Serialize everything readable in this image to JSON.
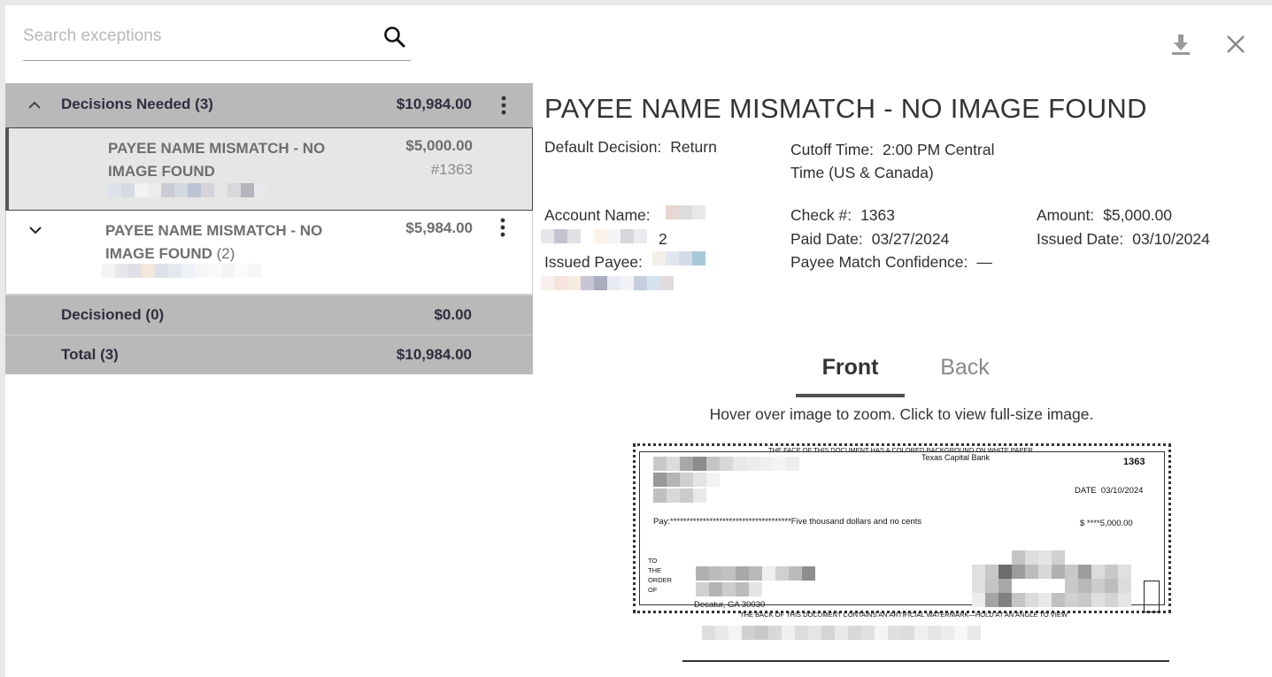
{
  "search": {
    "placeholder": "Search exceptions"
  },
  "toolbar": {
    "download_icon": "download-icon",
    "close_icon": "close-icon"
  },
  "list": {
    "decisions_needed": {
      "label": "Decisions Needed (3)",
      "amount": "$10,984.00"
    },
    "items": [
      {
        "title": "PAYEE NAME MISMATCH - NO IMAGE FOUND",
        "count": "",
        "amount": "$5,000.00",
        "check_number": "#1363",
        "selected": true
      },
      {
        "title": "PAYEE NAME MISMATCH - NO IMAGE FOUND",
        "count": "(2)",
        "amount": "$5,984.00",
        "check_number": "",
        "selected": false
      }
    ],
    "decisioned": {
      "label": "Decisioned (0)",
      "amount": "$0.00"
    },
    "total": {
      "label": "Total (3)",
      "amount": "$10,984.00"
    }
  },
  "detail": {
    "title": "PAYEE NAME MISMATCH - NO IMAGE FOUND",
    "default_decision_label": "Default Decision:",
    "default_decision": "Return",
    "cutoff_label": "Cutoff Time:",
    "cutoff_value": "2:00 PM Central Time (US & Canada)",
    "account_name_label": "Account Name:",
    "account_suffix": "2",
    "issued_payee_label": "Issued Payee:",
    "check_no_label": "Check #:",
    "check_no": "1363",
    "paid_date_label": "Paid Date:",
    "paid_date": "03/27/2024",
    "payee_conf_label": "Payee Match Confidence:",
    "payee_conf": "—",
    "amount_label": "Amount:",
    "amount": "$5,000.00",
    "issued_date_label": "Issued Date:",
    "issued_date": "03/10/2024",
    "tabs": {
      "front": "Front",
      "back": "Back"
    },
    "hint": "Hover over image to zoom. Click to view full-size image."
  },
  "check_image": {
    "top_banner": "THE FACE OF THIS DOCUMENT HAS A COLORED BACKGROUND ON WHITE PAPER",
    "bank": "Texas Capital Bank",
    "number": "1363",
    "date_label": "DATE",
    "date": "03/10/2024",
    "pay_line": "Pay:*************************************Five thousand dollars and no cents",
    "amount_line": "$    ****5,000.00",
    "to_the_order_of": [
      "TO",
      "THE",
      "ORDER",
      "OF"
    ],
    "payee_city": "Decatur, GA  30030",
    "bottom_banner": "THE BACK OF THIS DOCUMENT CONTAINS AN ARTIFICIAL WATERMARK—HOLD AT AN ANGLE TO VIEW"
  }
}
